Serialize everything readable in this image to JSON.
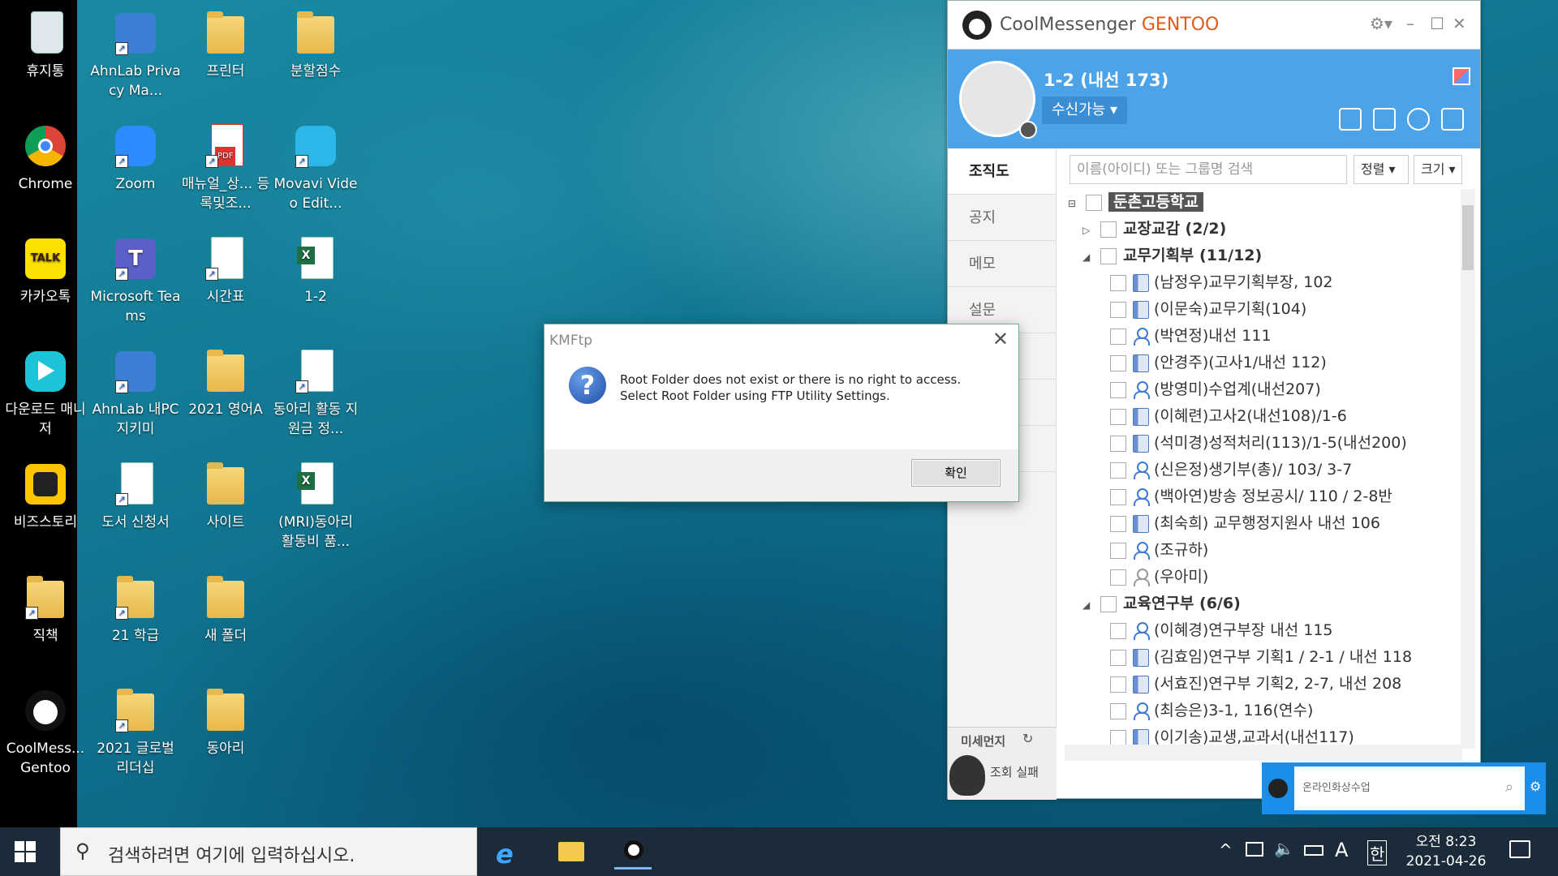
{
  "desktop_icons": [
    {
      "label": "휴지통",
      "icon": "recycle-bin-icon"
    },
    {
      "label": "Chrome",
      "icon": "chrome-icon"
    },
    {
      "label": "카카오톡",
      "icon": "kakaotalk-icon"
    },
    {
      "label": "다운로드 매니저",
      "icon": "download-manager-icon"
    },
    {
      "label": "비즈스토리",
      "icon": "bizstory-icon"
    },
    {
      "label": "직책",
      "icon": "folder-icon"
    },
    {
      "label": "CoolMess... Gentoo",
      "icon": "coolmessenger-icon"
    },
    {
      "label": "AhnLab Privacy Ma...",
      "icon": "ahnlab-icon"
    },
    {
      "label": "Zoom",
      "icon": "zoom-icon"
    },
    {
      "label": "Microsoft Teams",
      "icon": "teams-icon"
    },
    {
      "label": "AhnLab 내PC지키미",
      "icon": "ahnlab-icon"
    },
    {
      "label": "도서 신청서",
      "icon": "hwp-document-icon"
    },
    {
      "label": "21 학급",
      "icon": "folder-icon"
    },
    {
      "label": "2021 글로벌 리더십",
      "icon": "folder-icon"
    },
    {
      "label": "프린터",
      "icon": "folder-icon"
    },
    {
      "label": "매뉴얼_상... 등록및조...",
      "icon": "pdf-icon"
    },
    {
      "label": "시간표",
      "icon": "hwp-document-icon"
    },
    {
      "label": "2021 영어A",
      "icon": "folder-icon"
    },
    {
      "label": "사이트",
      "icon": "folder-icon"
    },
    {
      "label": "새 폴더",
      "icon": "folder-icon"
    },
    {
      "label": "동아리",
      "icon": "folder-icon"
    },
    {
      "label": "분할점수",
      "icon": "folder-icon"
    },
    {
      "label": "Movavi Video Edit...",
      "icon": "movavi-icon"
    },
    {
      "label": "1-2",
      "icon": "excel-icon"
    },
    {
      "label": "동아리 활동 지원금 정...",
      "icon": "hwp-document-icon"
    },
    {
      "label": "(MRI)동아리 활동비 품...",
      "icon": "excel-icon"
    }
  ],
  "messenger": {
    "title_cool": "Cool",
    "title_messenger": "Messenger",
    "title_gentoo": " GENTOO",
    "user_name": "1-2 (내선 173)",
    "status": "수신가능 ▾",
    "tabs": [
      "조직도",
      "공지",
      "메모",
      "설문"
    ],
    "search_placeholder": "이름(아이디) 또는 그룹명 검색",
    "sort_label": "정렬",
    "size_label": "크기",
    "dust_label": "미세먼지",
    "dust_status": "조회 실패",
    "tree": [
      {
        "level": 0,
        "type": "root",
        "label": "둔촌고등학교"
      },
      {
        "level": 1,
        "type": "group-collapsed",
        "label": "교장교감 (2/2)"
      },
      {
        "level": 1,
        "type": "group",
        "label": "교무기획부 (11/12)"
      },
      {
        "level": 2,
        "type": "book",
        "label": "(남정우)교무기획부장, 102"
      },
      {
        "level": 2,
        "type": "book",
        "label": "(이문숙)교무기획(104)"
      },
      {
        "level": 2,
        "type": "user",
        "label": "(박연정)내선 111"
      },
      {
        "level": 2,
        "type": "book",
        "label": "(안경주)(고사1/내선 112)"
      },
      {
        "level": 2,
        "type": "user",
        "label": "(방영미)수업계(내선207)"
      },
      {
        "level": 2,
        "type": "book",
        "label": "(이혜련)고사2(내선108)/1-6"
      },
      {
        "level": 2,
        "type": "book",
        "label": "(석미경)성적처리(113)/1-5(내선200)"
      },
      {
        "level": 2,
        "type": "user",
        "label": "(신은정)생기부(총)/ 103/ 3-7"
      },
      {
        "level": 2,
        "type": "user",
        "label": "(백아연)방송 정보공시/ 110 / 2-8반"
      },
      {
        "level": 2,
        "type": "book",
        "label": "(최숙희) 교무행정지원사 내선 106"
      },
      {
        "level": 2,
        "type": "user",
        "label": "(조규하)"
      },
      {
        "level": 2,
        "type": "user-off",
        "label": "(우아미)"
      },
      {
        "level": 1,
        "type": "group",
        "label": "교육연구부 (6/6)"
      },
      {
        "level": 2,
        "type": "user",
        "label": "(이혜경)연구부장 내선 115"
      },
      {
        "level": 2,
        "type": "book",
        "label": "(김효임)연구부 기획1 / 2-1 / 내선 118"
      },
      {
        "level": 2,
        "type": "book",
        "label": "(서효진)연구부 기획2, 2-7, 내선 208"
      },
      {
        "level": 2,
        "type": "user",
        "label": "(최승은)3-1, 116(연수)"
      },
      {
        "level": 2,
        "type": "book",
        "label": "(이기송)교생,교과서(내선117)"
      }
    ]
  },
  "dialog": {
    "title": "KMFtp",
    "line1": "Root Folder does not exist or there is no right to access.",
    "line2": "Select Root Folder using FTP Utility Settings.",
    "ok_label": "확인"
  },
  "widget_search": {
    "placeholder": "온라인화상수업"
  },
  "taskbar": {
    "search_placeholder": "검색하려면 여기에 입력하십시오.",
    "ime_label": "A",
    "hangul_label": "한",
    "time": "오전 8:23",
    "date": "2021-04-26"
  },
  "colors": {
    "accent": "#4ca3e8",
    "brand_orange": "#e05a1a",
    "taskbar": "#1c2b3a"
  }
}
